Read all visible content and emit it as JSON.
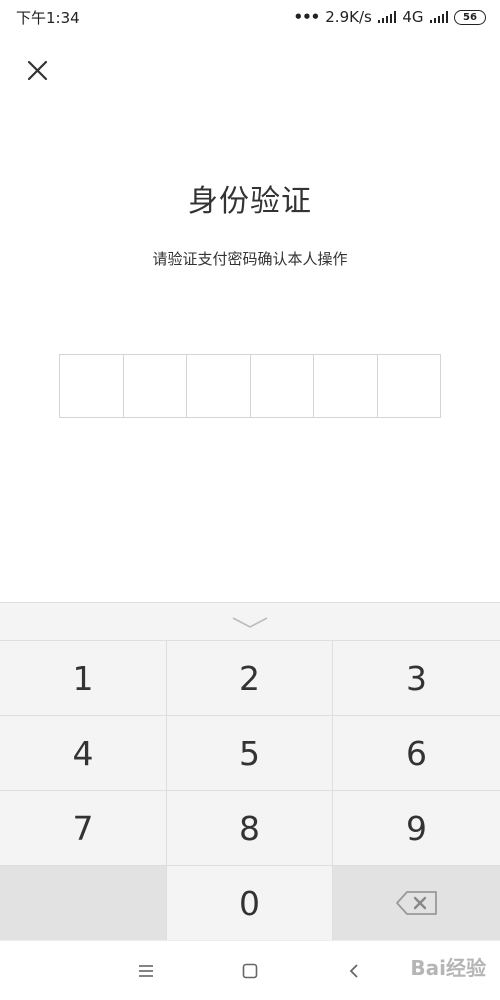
{
  "status_bar": {
    "time": "下午1:34",
    "speed": "2.9K/s",
    "network": "4G",
    "battery": "56"
  },
  "header": {
    "title": "身份验证",
    "subtitle": "请验证支付密码确认本人操作"
  },
  "pin": {
    "length": 6
  },
  "keyboard": {
    "keys": [
      "1",
      "2",
      "3",
      "4",
      "5",
      "6",
      "7",
      "8",
      "9",
      "",
      "0",
      ""
    ]
  },
  "watermark": "Bai经验"
}
